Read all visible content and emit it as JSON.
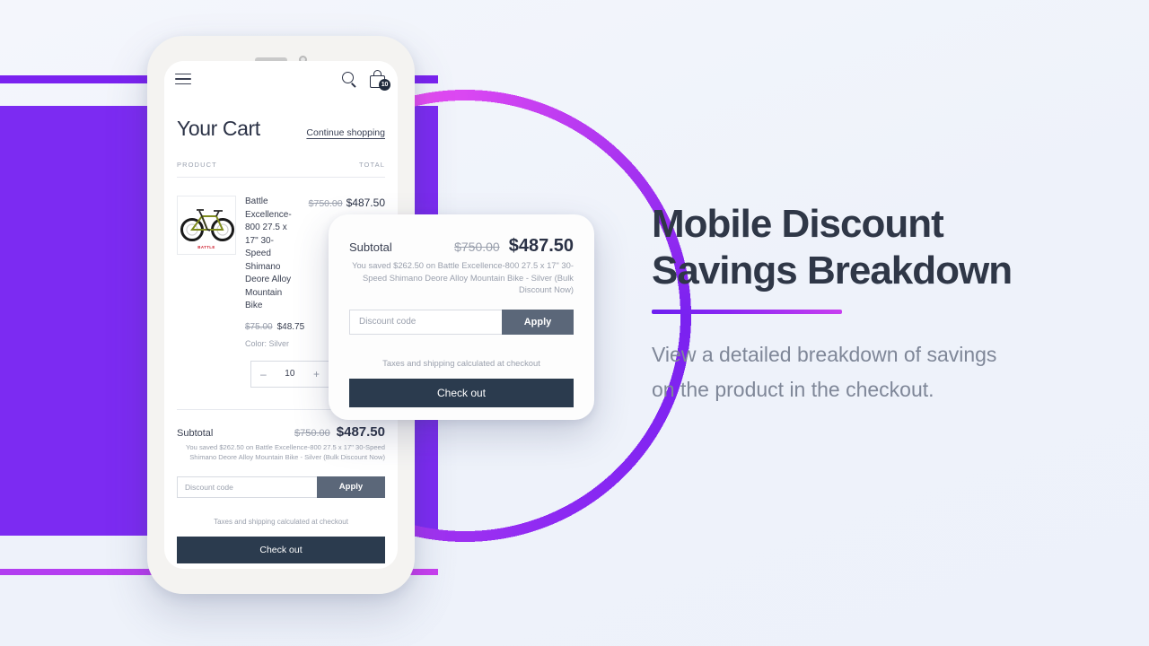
{
  "phone": {
    "nav": {
      "menu_icon": "hamburger-icon",
      "search_icon": "search-icon",
      "cart_icon": "shopping-bag-icon",
      "cart_count": "10"
    },
    "cart": {
      "title": "Your Cart",
      "continue_link": "Continue shopping",
      "col_product": "PRODUCT",
      "col_total": "TOTAL",
      "item": {
        "name": "Battle Excellence-800 27.5 x 17\" 30-Speed Shimano Deore Alloy Mountain Bike",
        "thumb_brand": "BATTLE",
        "unit_price_original": "$75.00",
        "unit_price_sale": "$48.75",
        "variant": "Color: Silver",
        "line_total_original": "$750.00",
        "line_total_sale": "$487.50",
        "qty_minus": "–",
        "qty_value": "10",
        "qty_plus": "+"
      }
    },
    "totals": {
      "label": "Subtotal",
      "price_original": "$750.00",
      "price_sale": "$487.50",
      "saved_note": "You saved $262.50 on Battle Excellence-800 27.5 x 17\" 30-Speed Shimano Deore Alloy Mountain Bike - Silver (Bulk Discount Now)",
      "discount_placeholder": "Discount code",
      "apply_label": "Apply",
      "taxes_note": "Taxes and shipping calculated at checkout",
      "checkout_label": "Check out"
    }
  },
  "float_card": {
    "label": "Subtotal",
    "price_original": "$750.00",
    "price_sale": "$487.50",
    "saved_note": "You saved $262.50 on Battle Excellence-800 27.5 x 17\" 30-Speed Shimano Deore Alloy Mountain Bike - Silver (Bulk Discount Now)",
    "discount_placeholder": "Discount code",
    "apply_label": "Apply",
    "taxes_note": "Taxes and shipping calculated at checkout",
    "checkout_label": "Check out"
  },
  "panel": {
    "title_line1": "Mobile Discount",
    "title_line2": "Savings Breakdown",
    "subtitle": "View a detailed breakdown of savings on the product in the checkout."
  },
  "colors": {
    "background": "#eef2fa",
    "purple": "#7c2bf2",
    "magenta": "#c93ef0",
    "dark_navy": "#2b3b4e",
    "slate_button": "#5b6779",
    "heading": "#2f3747",
    "muted_text": "#9aa0ad"
  }
}
